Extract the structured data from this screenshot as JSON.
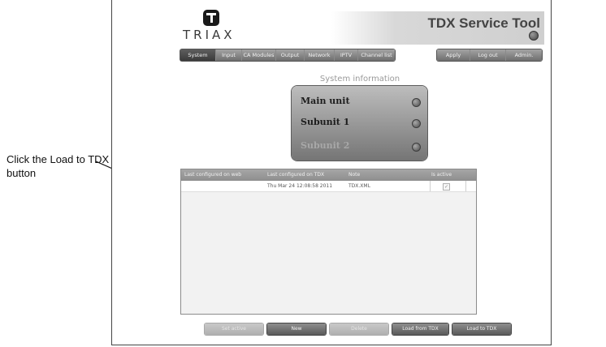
{
  "annotation": {
    "text": "Click the Load to TDX button"
  },
  "logo": {
    "text": "TRIAX"
  },
  "header": {
    "title": "TDX Service Tool"
  },
  "nav": {
    "tabs": [
      {
        "label": "System"
      },
      {
        "label": "Input"
      },
      {
        "label": "CA Modules"
      },
      {
        "label": "Output"
      },
      {
        "label": "Network"
      },
      {
        "label": "IPTV"
      },
      {
        "label": "Channel list"
      }
    ],
    "actions": [
      {
        "label": "Apply"
      },
      {
        "label": "Log out"
      },
      {
        "label": "Admin."
      }
    ]
  },
  "system_info": {
    "title": "System information",
    "units": [
      {
        "label": "Main unit"
      },
      {
        "label": "Subunit 1"
      },
      {
        "label": "Subunit 2"
      }
    ]
  },
  "table": {
    "headers": [
      "Last configured on web",
      "Last configured on TDX",
      "Note",
      "Is active"
    ],
    "rows": [
      {
        "web": "",
        "tdx": "Thu Mar 24 12:08:58 2011",
        "note": "TDX.XML",
        "active": "✓"
      }
    ]
  },
  "buttons": {
    "set_active": "Set active",
    "new": "New",
    "delete": "Delete",
    "load_from_tdx": "Load from TDX",
    "load_to_tdx": "Load to TDX"
  }
}
